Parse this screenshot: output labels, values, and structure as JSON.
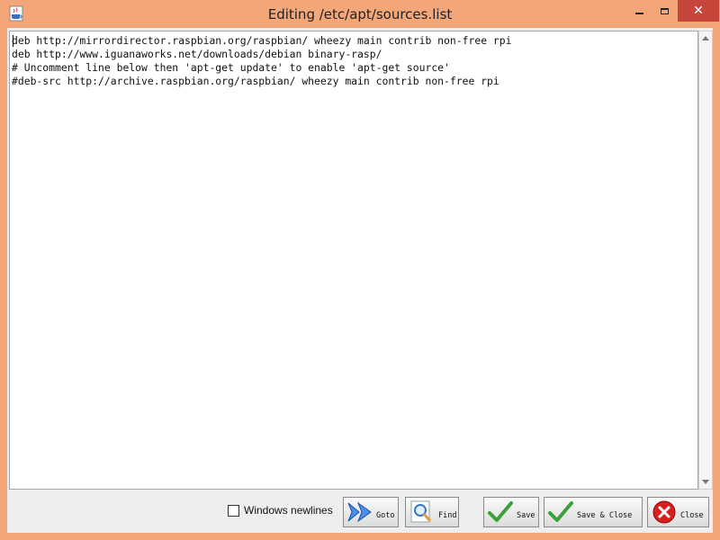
{
  "window": {
    "title": "Editing /etc/apt/sources.list"
  },
  "editor": {
    "content": "deb http://mirrordirector.raspbian.org/raspbian/ wheezy main contrib non-free rpi\ndeb http://www.iguanaworks.net/downloads/debian binary-rasp/\n# Uncomment line below then 'apt-get update' to enable 'apt-get source'\n#deb-src http://archive.raspbian.org/raspbian/ wheezy main contrib non-free rpi"
  },
  "options": {
    "windows_newlines_label": "Windows newlines",
    "windows_newlines_checked": false
  },
  "buttons": {
    "goto_label": "Goto",
    "find_label": "Find",
    "save_label": "Save",
    "save_close_label": "Save & Close",
    "close_label": "Close"
  },
  "colors": {
    "titlebar": "#f3a677",
    "close_window": "#c7463c",
    "goto_arrow": "#2a6fd6",
    "check_green": "#3aa13a",
    "close_red": "#d61f1f"
  },
  "icons": {
    "app": "java-cup-icon",
    "goto": "double-arrow-icon",
    "find": "magnifier-icon",
    "save": "checkmark-icon",
    "close": "red-x-circle-icon"
  }
}
